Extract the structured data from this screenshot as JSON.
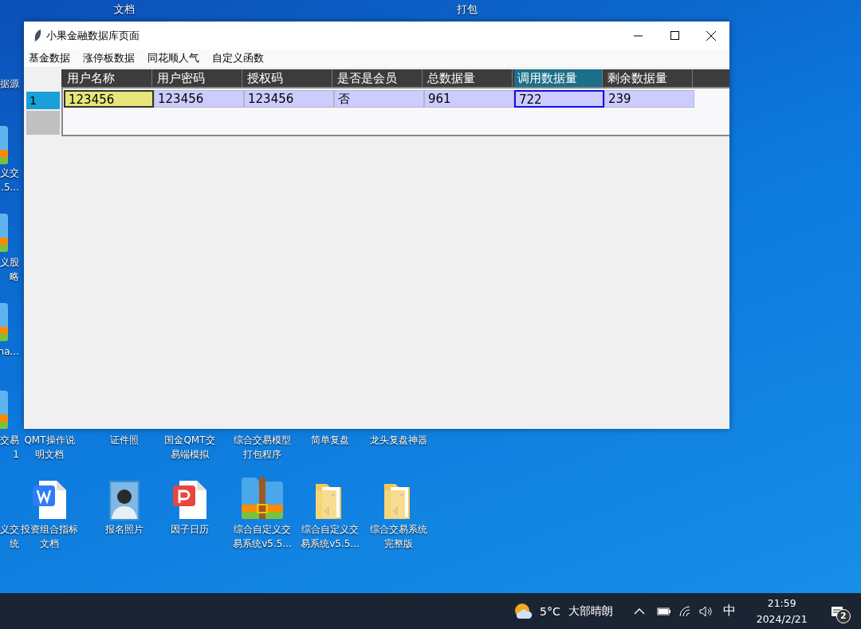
{
  "desktop": {
    "top_labels": [
      "文档",
      "打包"
    ],
    "left_edge_items": [
      {
        "lines": [
          "据源"
        ]
      },
      {
        "lines": [
          "义交",
          ".5..."
        ],
        "kind": "archive"
      },
      {
        "lines": [
          "义股",
          "略"
        ],
        "kind": "archive"
      },
      {
        "lines": [
          "na..."
        ],
        "kind": "archive"
      },
      {
        "lines": [
          "交易",
          "1"
        ],
        "kind": "archive"
      },
      {
        "lines": [
          "义交",
          "统"
        ]
      }
    ],
    "icon_rows": [
      [
        {
          "lines": [
            "QMT操作说",
            "明文档"
          ]
        },
        {
          "lines": [
            "证件照"
          ]
        },
        {
          "lines": [
            "国金QMT交",
            "易端模拟"
          ]
        },
        {
          "lines": [
            "综合交易模型",
            "打包程序"
          ]
        },
        {
          "lines": [
            "简单复盘"
          ]
        },
        {
          "lines": [
            "龙头复盘神器"
          ]
        }
      ],
      [
        {
          "lines": [
            "投资组合指标",
            "文档"
          ],
          "kind": "word"
        },
        {
          "lines": [
            "报名照片"
          ]
        },
        {
          "lines": [
            "因子日历"
          ],
          "kind": "pdf"
        },
        {
          "lines": [
            "综合自定义交",
            "易系统v5.5..."
          ],
          "kind": "zip"
        },
        {
          "lines": [
            "综合自定义交",
            "易系统v5.5..."
          ],
          "kind": "folder"
        },
        {
          "lines": [
            "综合交易系统",
            "完整版"
          ],
          "kind": "folder"
        }
      ]
    ]
  },
  "window": {
    "title": "小果金融数据库页面",
    "menu": [
      "基金数据",
      "涨停板数据",
      "同花顺人气",
      "自定义函数"
    ],
    "table": {
      "columns": [
        {
          "label": "用户名称",
          "selected": false
        },
        {
          "label": "用户密码",
          "selected": false
        },
        {
          "label": "授权码",
          "selected": false
        },
        {
          "label": "是否是会员",
          "selected": false
        },
        {
          "label": "总数据量",
          "selected": false
        },
        {
          "label": "调用数据量",
          "selected": true
        },
        {
          "label": "剩余数据量",
          "selected": false
        }
      ],
      "rows": [
        {
          "index": "1",
          "selected": true,
          "cells": [
            {
              "text": "123456",
              "editing": true,
              "selected": false
            },
            {
              "text": "123456",
              "editing": false,
              "selected": false
            },
            {
              "text": "123456",
              "editing": false,
              "selected": false
            },
            {
              "text": "否",
              "editing": false,
              "selected": false
            },
            {
              "text": "961",
              "editing": false,
              "selected": false
            },
            {
              "text": "722",
              "editing": false,
              "selected": true
            },
            {
              "text": "239",
              "editing": false,
              "selected": false
            }
          ]
        }
      ]
    }
  },
  "taskbar": {
    "temperature": "5°C",
    "weather": "大部晴朗",
    "input_method": "中",
    "time": "21:59",
    "date": "2024/2/21",
    "notifications": "2"
  }
}
